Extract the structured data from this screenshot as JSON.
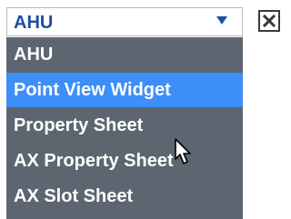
{
  "select": {
    "value": "AHU",
    "arrow_icon": "triangle-down-icon"
  },
  "close_icon": "close-x-icon",
  "dropdown": {
    "options": [
      {
        "label": "AHU",
        "highlighted": false
      },
      {
        "label": "Point View Widget",
        "highlighted": true
      },
      {
        "label": "Property Sheet",
        "highlighted": false
      },
      {
        "label": "AX Property Sheet",
        "highlighted": false
      },
      {
        "label": "AX Slot Sheet",
        "highlighted": false
      }
    ]
  },
  "cursor_icon": "mouse-pointer-icon",
  "colors": {
    "select_text": "#1f4fa3",
    "dropdown_bg": "#5d6670",
    "highlight_bg": "#3d8ef7",
    "option_text": "#ffffff"
  }
}
